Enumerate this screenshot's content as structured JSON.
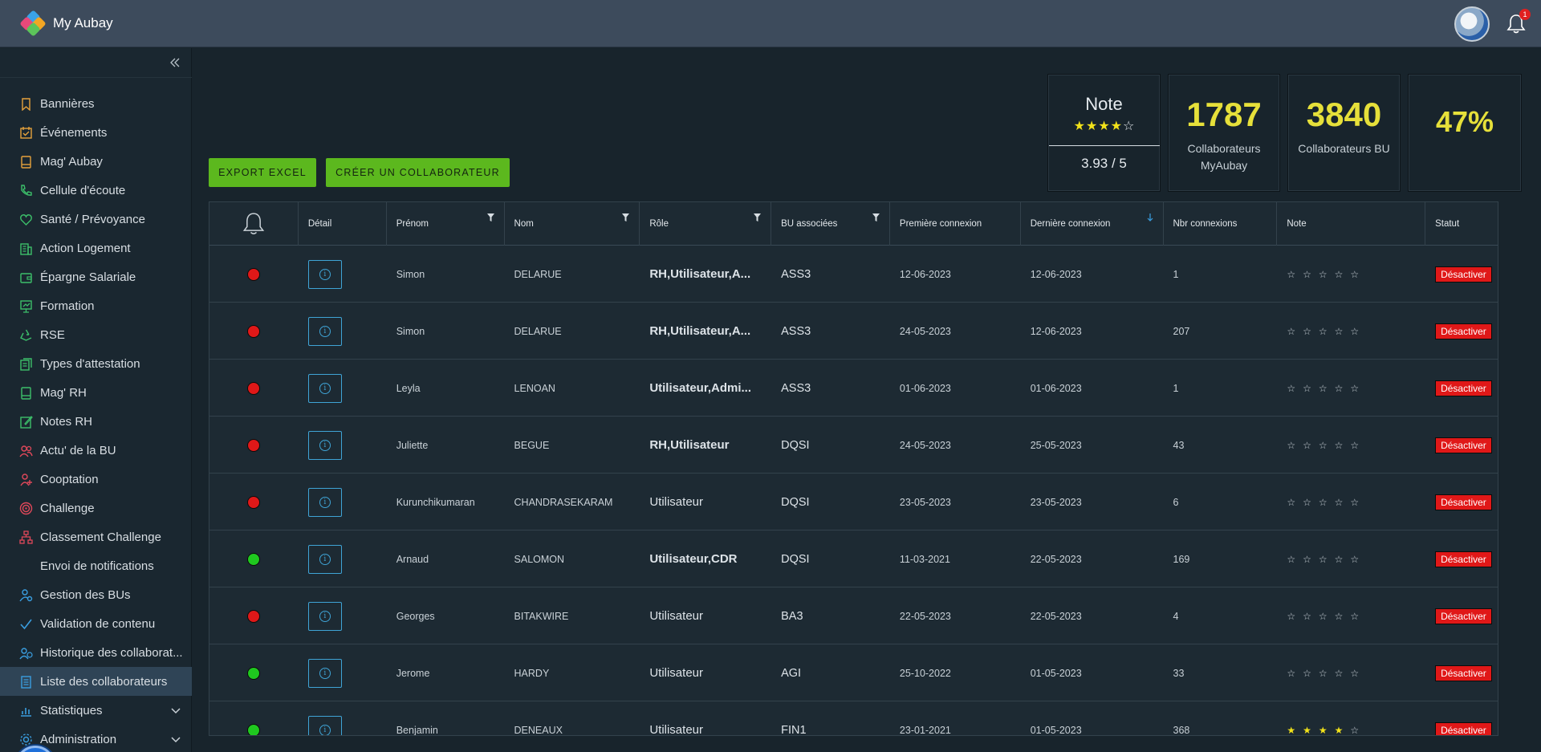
{
  "app": {
    "title": "My Aubay",
    "notification_count": "1"
  },
  "sidebar": {
    "items": [
      {
        "label": "Bannières",
        "icon": "bookmark-icon",
        "color": "#e6a23c",
        "active": false
      },
      {
        "label": "Événements",
        "icon": "calendar-check-icon",
        "color": "#e6a23c",
        "active": false
      },
      {
        "label": "Mag' Aubay",
        "icon": "book-icon",
        "color": "#e6a23c",
        "active": false
      },
      {
        "label": "Cellule d'écoute",
        "icon": "phone-icon",
        "color": "#3cbf6a",
        "active": false
      },
      {
        "label": "Santé / Prévoyance",
        "icon": "heart-icon",
        "color": "#3cbf6a",
        "active": false
      },
      {
        "label": "Action Logement",
        "icon": "building-icon",
        "color": "#3cbf6a",
        "active": false
      },
      {
        "label": "Épargne Salariale",
        "icon": "wallet-icon",
        "color": "#3cbf6a",
        "active": false
      },
      {
        "label": "Formation",
        "icon": "presentation-icon",
        "color": "#3cbf6a",
        "active": false
      },
      {
        "label": "RSE",
        "icon": "recycle-icon",
        "color": "#3cbf6a",
        "active": false
      },
      {
        "label": "Types d'attestation",
        "icon": "documents-icon",
        "color": "#3cbf6a",
        "active": false
      },
      {
        "label": "Mag' RH",
        "icon": "book-icon",
        "color": "#3cbf6a",
        "active": false
      },
      {
        "label": "Notes RH",
        "icon": "edit-note-icon",
        "color": "#3cbf6a",
        "active": false
      },
      {
        "label": "Actu' de la BU",
        "icon": "users-icon",
        "color": "#e0485a",
        "active": false
      },
      {
        "label": "Cooptation",
        "icon": "user-add-icon",
        "color": "#e0485a",
        "active": false
      },
      {
        "label": "Challenge",
        "icon": "target-icon",
        "color": "#e0485a",
        "active": false
      },
      {
        "label": "Classement Challenge",
        "icon": "hierarchy-icon",
        "color": "#e0485a",
        "active": false
      },
      {
        "label": "Envoi de notifications",
        "icon": "bell-icon",
        "color": "#3a9ee0",
        "active": false
      },
      {
        "label": "Gestion des BUs",
        "icon": "user-settings-icon",
        "color": "#3a9ee0",
        "active": false
      },
      {
        "label": "Validation de contenu",
        "icon": "check-icon",
        "color": "#3a9ee0",
        "active": false
      },
      {
        "label": "Historique des collaborat...",
        "icon": "users-history-icon",
        "color": "#3a9ee0",
        "active": false
      },
      {
        "label": "Liste des collaborateurs",
        "icon": "list-icon",
        "color": "#3a9ee0",
        "active": true
      },
      {
        "label": "Statistiques",
        "icon": "chart-icon",
        "color": "#3a9ee0",
        "active": false,
        "expandable": true
      },
      {
        "label": "Administration",
        "icon": "gear-icon",
        "color": "#3a9ee0",
        "active": false,
        "expandable": true
      }
    ]
  },
  "actions": {
    "export_label": "Export Excel",
    "create_label": "Créer un collaborateur"
  },
  "stats": {
    "note": {
      "title": "Note",
      "stars_filled": 4,
      "stars_total": 5,
      "value": "3.93 / 5"
    },
    "collaborateurs": {
      "value": "1787",
      "label_line1": "Collaborateurs",
      "label_line2": "MyAubay"
    },
    "collaborateurs_bu": {
      "value": "3840",
      "label": "Collaborateurs BU"
    },
    "percent": {
      "value": "47%"
    }
  },
  "table": {
    "headers": {
      "detail": "Détail",
      "prenom": "Prénom",
      "nom": "Nom",
      "role": "Rôle",
      "bu": "BU associées",
      "premiere": "Première connexion",
      "derniere": "Dernière connexion",
      "nbr": "Nbr connexions",
      "note": "Note",
      "statut": "Statut"
    },
    "status_colors": {
      "red": "#e01818",
      "green": "#1fc81f"
    },
    "rows": [
      {
        "status": "red",
        "prenom": "Simon",
        "nom": "DELARUE",
        "role": "RH,Utilisateur,A...",
        "role_bold": true,
        "bu": "ASS3",
        "premiere": "12-06-2023",
        "derniere": "12-06-2023",
        "nbr": "1",
        "stars": 0,
        "action": "Désactiver"
      },
      {
        "status": "red",
        "prenom": "Simon",
        "nom": "DELARUE",
        "role": "RH,Utilisateur,A...",
        "role_bold": true,
        "bu": "ASS3",
        "premiere": "24-05-2023",
        "derniere": "12-06-2023",
        "nbr": "207",
        "stars": 0,
        "action": "Désactiver"
      },
      {
        "status": "red",
        "prenom": "Leyla",
        "nom": "LENOAN",
        "role": "Utilisateur,Admi...",
        "role_bold": true,
        "bu": "ASS3",
        "premiere": "01-06-2023",
        "derniere": "01-06-2023",
        "nbr": "1",
        "stars": 0,
        "action": "Désactiver"
      },
      {
        "status": "red",
        "prenom": "Juliette",
        "nom": "BEGUE",
        "role": "RH,Utilisateur",
        "role_bold": true,
        "bu": "DQSI",
        "premiere": "24-05-2023",
        "derniere": "25-05-2023",
        "nbr": "43",
        "stars": 0,
        "action": "Désactiver"
      },
      {
        "status": "red",
        "prenom": "Kurunchikumaran",
        "nom": "CHANDRASEKARAM",
        "role": "Utilisateur",
        "role_bold": false,
        "bu": "DQSI",
        "premiere": "23-05-2023",
        "derniere": "23-05-2023",
        "nbr": "6",
        "stars": 0,
        "action": "Désactiver"
      },
      {
        "status": "green",
        "prenom": "Arnaud",
        "nom": "SALOMON",
        "role": "Utilisateur,CDR",
        "role_bold": true,
        "bu": "DQSI",
        "premiere": "11-03-2021",
        "derniere": "22-05-2023",
        "nbr": "169",
        "stars": 0,
        "action": "Désactiver"
      },
      {
        "status": "red",
        "prenom": "Georges",
        "nom": "BITAKWIRE",
        "role": "Utilisateur",
        "role_bold": false,
        "bu": "BA3",
        "premiere": "22-05-2023",
        "derniere": "22-05-2023",
        "nbr": "4",
        "stars": 0,
        "action": "Désactiver"
      },
      {
        "status": "green",
        "prenom": "Jerome",
        "nom": "HARDY",
        "role": "Utilisateur",
        "role_bold": false,
        "bu": "AGI",
        "premiere": "25-10-2022",
        "derniere": "01-05-2023",
        "nbr": "33",
        "stars": 0,
        "action": "Désactiver"
      },
      {
        "status": "green",
        "prenom": "Benjamin",
        "nom": "DENEAUX",
        "role": "Utilisateur",
        "role_bold": false,
        "bu": "FIN1",
        "premiere": "23-01-2021",
        "derniere": "01-05-2023",
        "nbr": "368",
        "stars": 4,
        "action": "Désactiver"
      }
    ]
  }
}
